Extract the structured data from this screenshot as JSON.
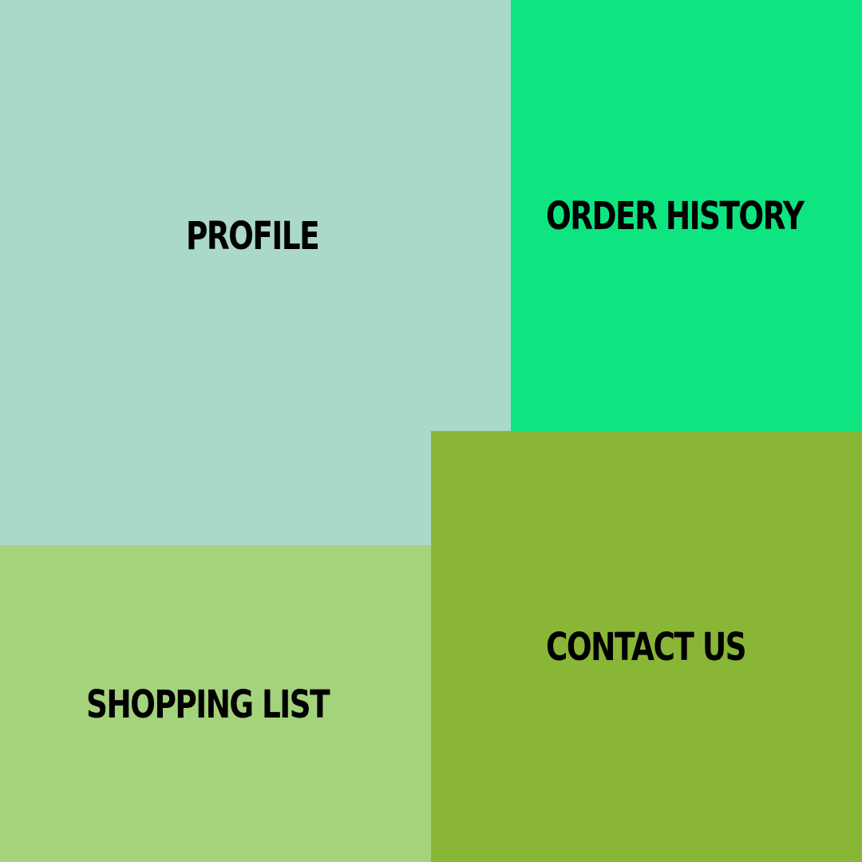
{
  "tiles": {
    "profile": {
      "label": "PROFILE",
      "color": "#AAD8CA"
    },
    "order_history": {
      "label": "ORDER HISTORY",
      "color": "#0EE580"
    },
    "shopping_list": {
      "label": "SHOPPING LIST",
      "color": "#A5D37C"
    },
    "contact_us": {
      "label": "CONTACT US",
      "color": "#8AB638"
    }
  }
}
